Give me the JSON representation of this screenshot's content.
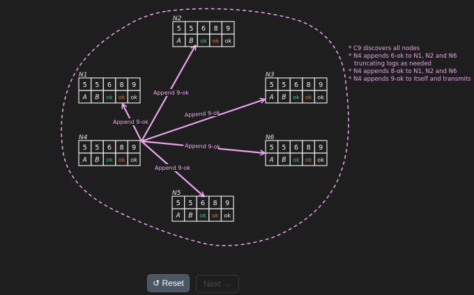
{
  "nodes": [
    {
      "id": "N2",
      "label": "N2",
      "terms": [
        "5",
        "5",
        "6",
        "8",
        "9"
      ],
      "values": [
        "A",
        "B",
        "ok",
        "ok",
        "ok"
      ]
    },
    {
      "id": "N1",
      "label": "N1",
      "terms": [
        "5",
        "5",
        "6",
        "8",
        "9"
      ],
      "values": [
        "A",
        "B",
        "ok",
        "ok",
        "ok"
      ]
    },
    {
      "id": "N3",
      "label": "N3",
      "terms": [
        "5",
        "5",
        "6",
        "8",
        "9"
      ],
      "values": [
        "A",
        "B",
        "ok",
        "ok",
        "ok"
      ]
    },
    {
      "id": "N4",
      "label": "N4",
      "terms": [
        "5",
        "5",
        "6",
        "8",
        "9"
      ],
      "values": [
        "A",
        "B",
        "ok",
        "ok",
        "ok"
      ]
    },
    {
      "id": "N6",
      "label": "N6",
      "terms": [
        "5",
        "5",
        "6",
        "8",
        "9"
      ],
      "values": [
        "A",
        "B",
        "ok",
        "ok",
        "ok"
      ]
    },
    {
      "id": "N5",
      "label": "N5",
      "terms": [
        "5",
        "5",
        "6",
        "8",
        "9"
      ],
      "values": [
        "A",
        "B",
        "ok",
        "ok",
        "ok"
      ]
    }
  ],
  "arrows": [
    {
      "to": "N2",
      "label": "Append 9-ok"
    },
    {
      "to": "N1",
      "label": "Append 9-ok"
    },
    {
      "to": "N3",
      "label": "Append 9-ok"
    },
    {
      "to": "N6",
      "label": "Append 9-ok"
    },
    {
      "to": "N5",
      "label": "Append 9-ok"
    }
  ],
  "notes": [
    "* C9 discovers all nodes",
    "* N4 appends 6-ok to N1, N2 and N6",
    "truncating logs as needed",
    "* N4 appends 8-ok to N1, N2 and N6",
    "* N4 appends 9-ok to itself and transmits"
  ],
  "buttons": {
    "reset_label": "↺ Reset",
    "next_label": "Next →"
  },
  "colors": {
    "term_6": "#4fc08d",
    "term_8": "#e07b39",
    "ok_green": "#4fc08d",
    "ok_orange": "#e07b39",
    "ok_white": "#f2f2f2",
    "accent": "#f0a5f0",
    "boundary": "#f0a5f0"
  }
}
